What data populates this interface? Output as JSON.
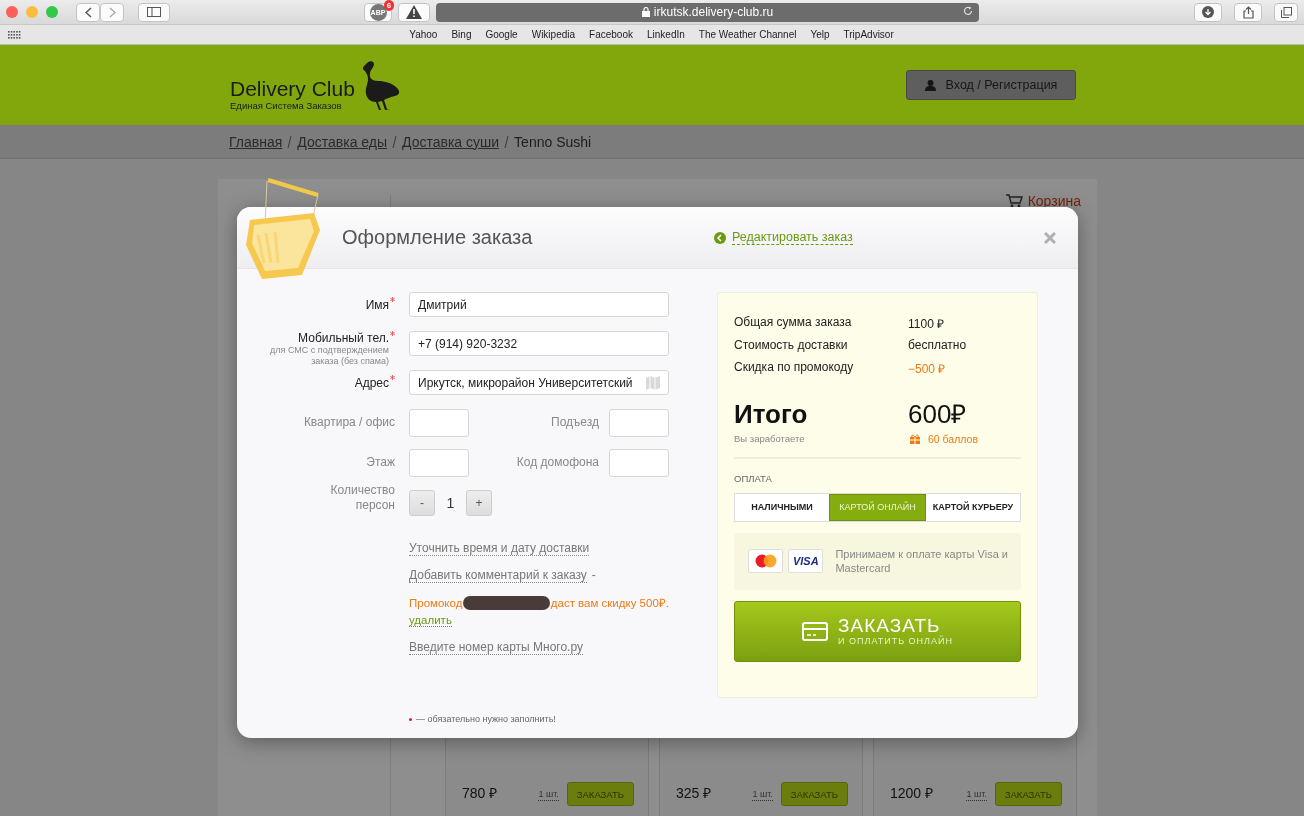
{
  "browser": {
    "adblock_label": "ABP",
    "adblock_badge": "6",
    "address": "irkutsk.delivery-club.ru",
    "bookmarks": [
      "Yahoo",
      "Bing",
      "Google",
      "Wikipedia",
      "Facebook",
      "LinkedIn",
      "The Weather Channel",
      "Yelp",
      "TripAdvisor"
    ]
  },
  "header": {
    "logo_title": "Delivery Club",
    "logo_subtitle": "Единая Система Заказов",
    "login_button": "Вход / Регистрация"
  },
  "breadcrumbs": [
    {
      "label": "Главная",
      "link": true
    },
    {
      "label": "Доставка еды",
      "link": true
    },
    {
      "label": "Доставка суши",
      "link": true
    },
    {
      "label": "Tenno Sushi",
      "link": false
    }
  ],
  "cart_link": "Корзина",
  "products": [
    {
      "price": "780 ₽",
      "quantity": "1 шт.",
      "order_button": "ЗАКАЗАТЬ"
    },
    {
      "price": "325 ₽",
      "quantity": "1 шт.",
      "order_button": "ЗАКАЗАТЬ"
    },
    {
      "price": "1200 ₽",
      "quantity": "1 шт.",
      "order_button": "ЗАКАЗАТЬ"
    }
  ],
  "modal": {
    "title": "Оформление заказа",
    "edit_link": "Редактировать заказ",
    "fields": [
      {
        "label": "Имя",
        "required": true,
        "value": "Дмитрий"
      },
      {
        "label": "Мобильный тел.",
        "hint": "для СМС с подтверждением заказа (без спама)",
        "required": true,
        "value": "+7 (914) 920-3232"
      },
      {
        "label": "Адрес",
        "required": true,
        "value": "Иркутск, микрорайон Университетский"
      }
    ],
    "small_fields": [
      {
        "label": "Квартира / офис"
      },
      {
        "label": "Подъезд"
      },
      {
        "label": "Этаж"
      },
      {
        "label": "Код домофона"
      }
    ],
    "persons": {
      "label": "Количество персон",
      "minus": "-",
      "value": "1",
      "plus": "+"
    },
    "links": [
      {
        "label": "Уточнить время и дату доставки"
      },
      {
        "label": "Добавить комментарий к заказу",
        "suffix": "-"
      }
    ],
    "promo": {
      "prefix": "Промокод",
      "suffix": "даст вам скидку 500₽.",
      "remove_link": "удалить"
    },
    "card_link": "Введите номер карты Много.ру",
    "required_note": "— обязательно нужно заполнить!",
    "summary": {
      "rows": [
        {
          "label": "Общая сумма заказа",
          "value": "1100 ₽",
          "kind": "normal"
        },
        {
          "label": "Стоимость доставки",
          "value": "бесплатно",
          "kind": "normal"
        },
        {
          "label": "Скидка по промокоду",
          "value": "−500 ₽",
          "kind": "discount"
        }
      ],
      "total_label": "Итого",
      "total_value": "600₽",
      "earn_label": "Вы заработаете",
      "earn_value": "60 баллов"
    },
    "payment": {
      "label": "ОПЛАТА",
      "options": [
        {
          "label": "НАЛИЧНЫМИ",
          "selected": false
        },
        {
          "label": "КАРТОЙ ОНЛАЙН",
          "selected": true
        },
        {
          "label": "КАРТОЙ КУРЬЕРУ",
          "selected": false
        }
      ],
      "visa_label": "VISA",
      "cards_note": "Принимаем к оплате карты Visa и Mastercard"
    },
    "submit": {
      "title": "ЗАКАЗАТЬ",
      "subtitle": "И ОПЛАТИТЬ ОНЛАЙН"
    }
  }
}
